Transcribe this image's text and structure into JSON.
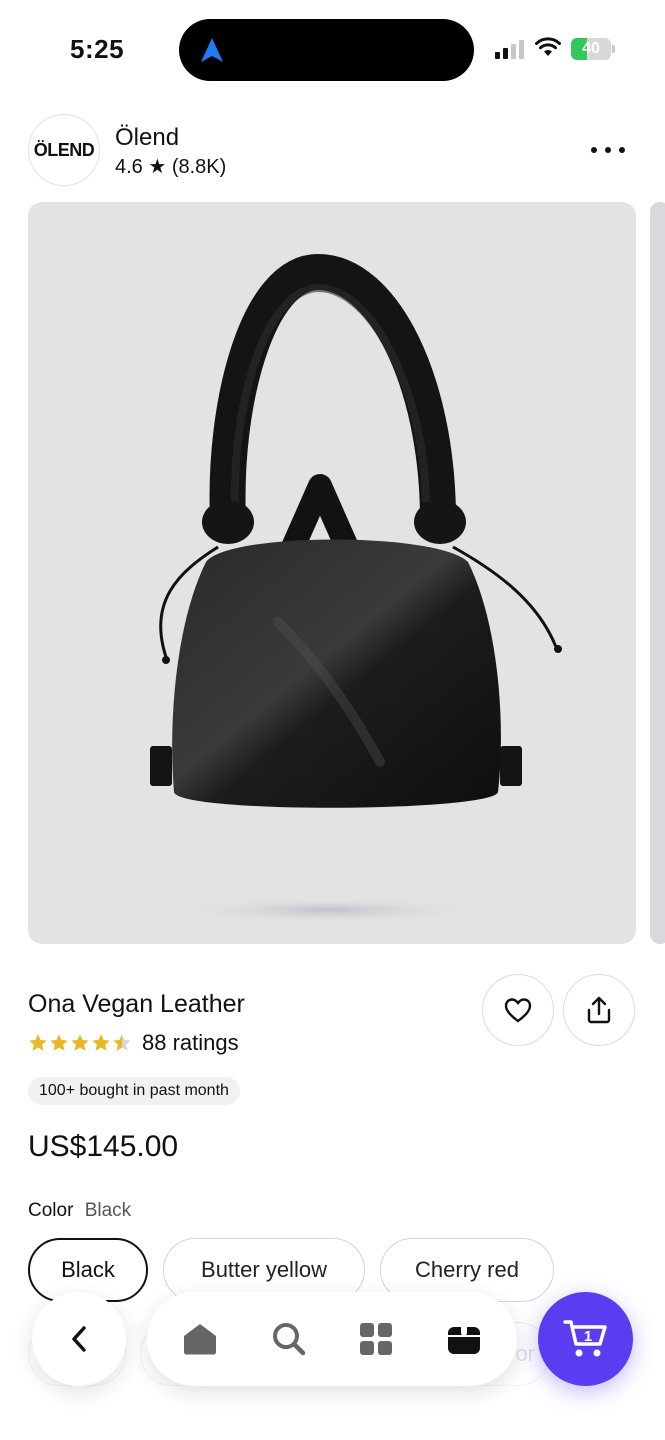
{
  "status_bar": {
    "time": "5:25",
    "battery": "40",
    "battery_level": 0.4,
    "battery_color": "#34c759",
    "icons": [
      "location-arrow-icon",
      "signal-icon",
      "wifi-icon",
      "battery-icon"
    ]
  },
  "shop": {
    "logo_text": "ÖLEND",
    "name": "Ölend",
    "rating": "4.6 ★ (8.8K)"
  },
  "product": {
    "image_alt_icon": "black-handbag",
    "title": "Ona Vegan Leather",
    "rating_stars": 4.5,
    "ratings_text": "88 ratings",
    "bought_badge": "100+ bought in past month",
    "price": "US$145.00",
    "color_label": "Color",
    "color_value": "Black",
    "color_options": [
      "Black",
      "Butter yellow",
      "Cherry red"
    ],
    "color_options_row2_partial": "or",
    "star_color": "#e8b923"
  },
  "actions": {
    "favorite_icon": "heart-icon",
    "share_icon": "share-icon"
  },
  "bottom_nav": {
    "items": [
      "home-icon",
      "search-icon",
      "categories-icon",
      "orders-icon"
    ],
    "cart_count": "1",
    "cart_color": "#5a3df0"
  }
}
